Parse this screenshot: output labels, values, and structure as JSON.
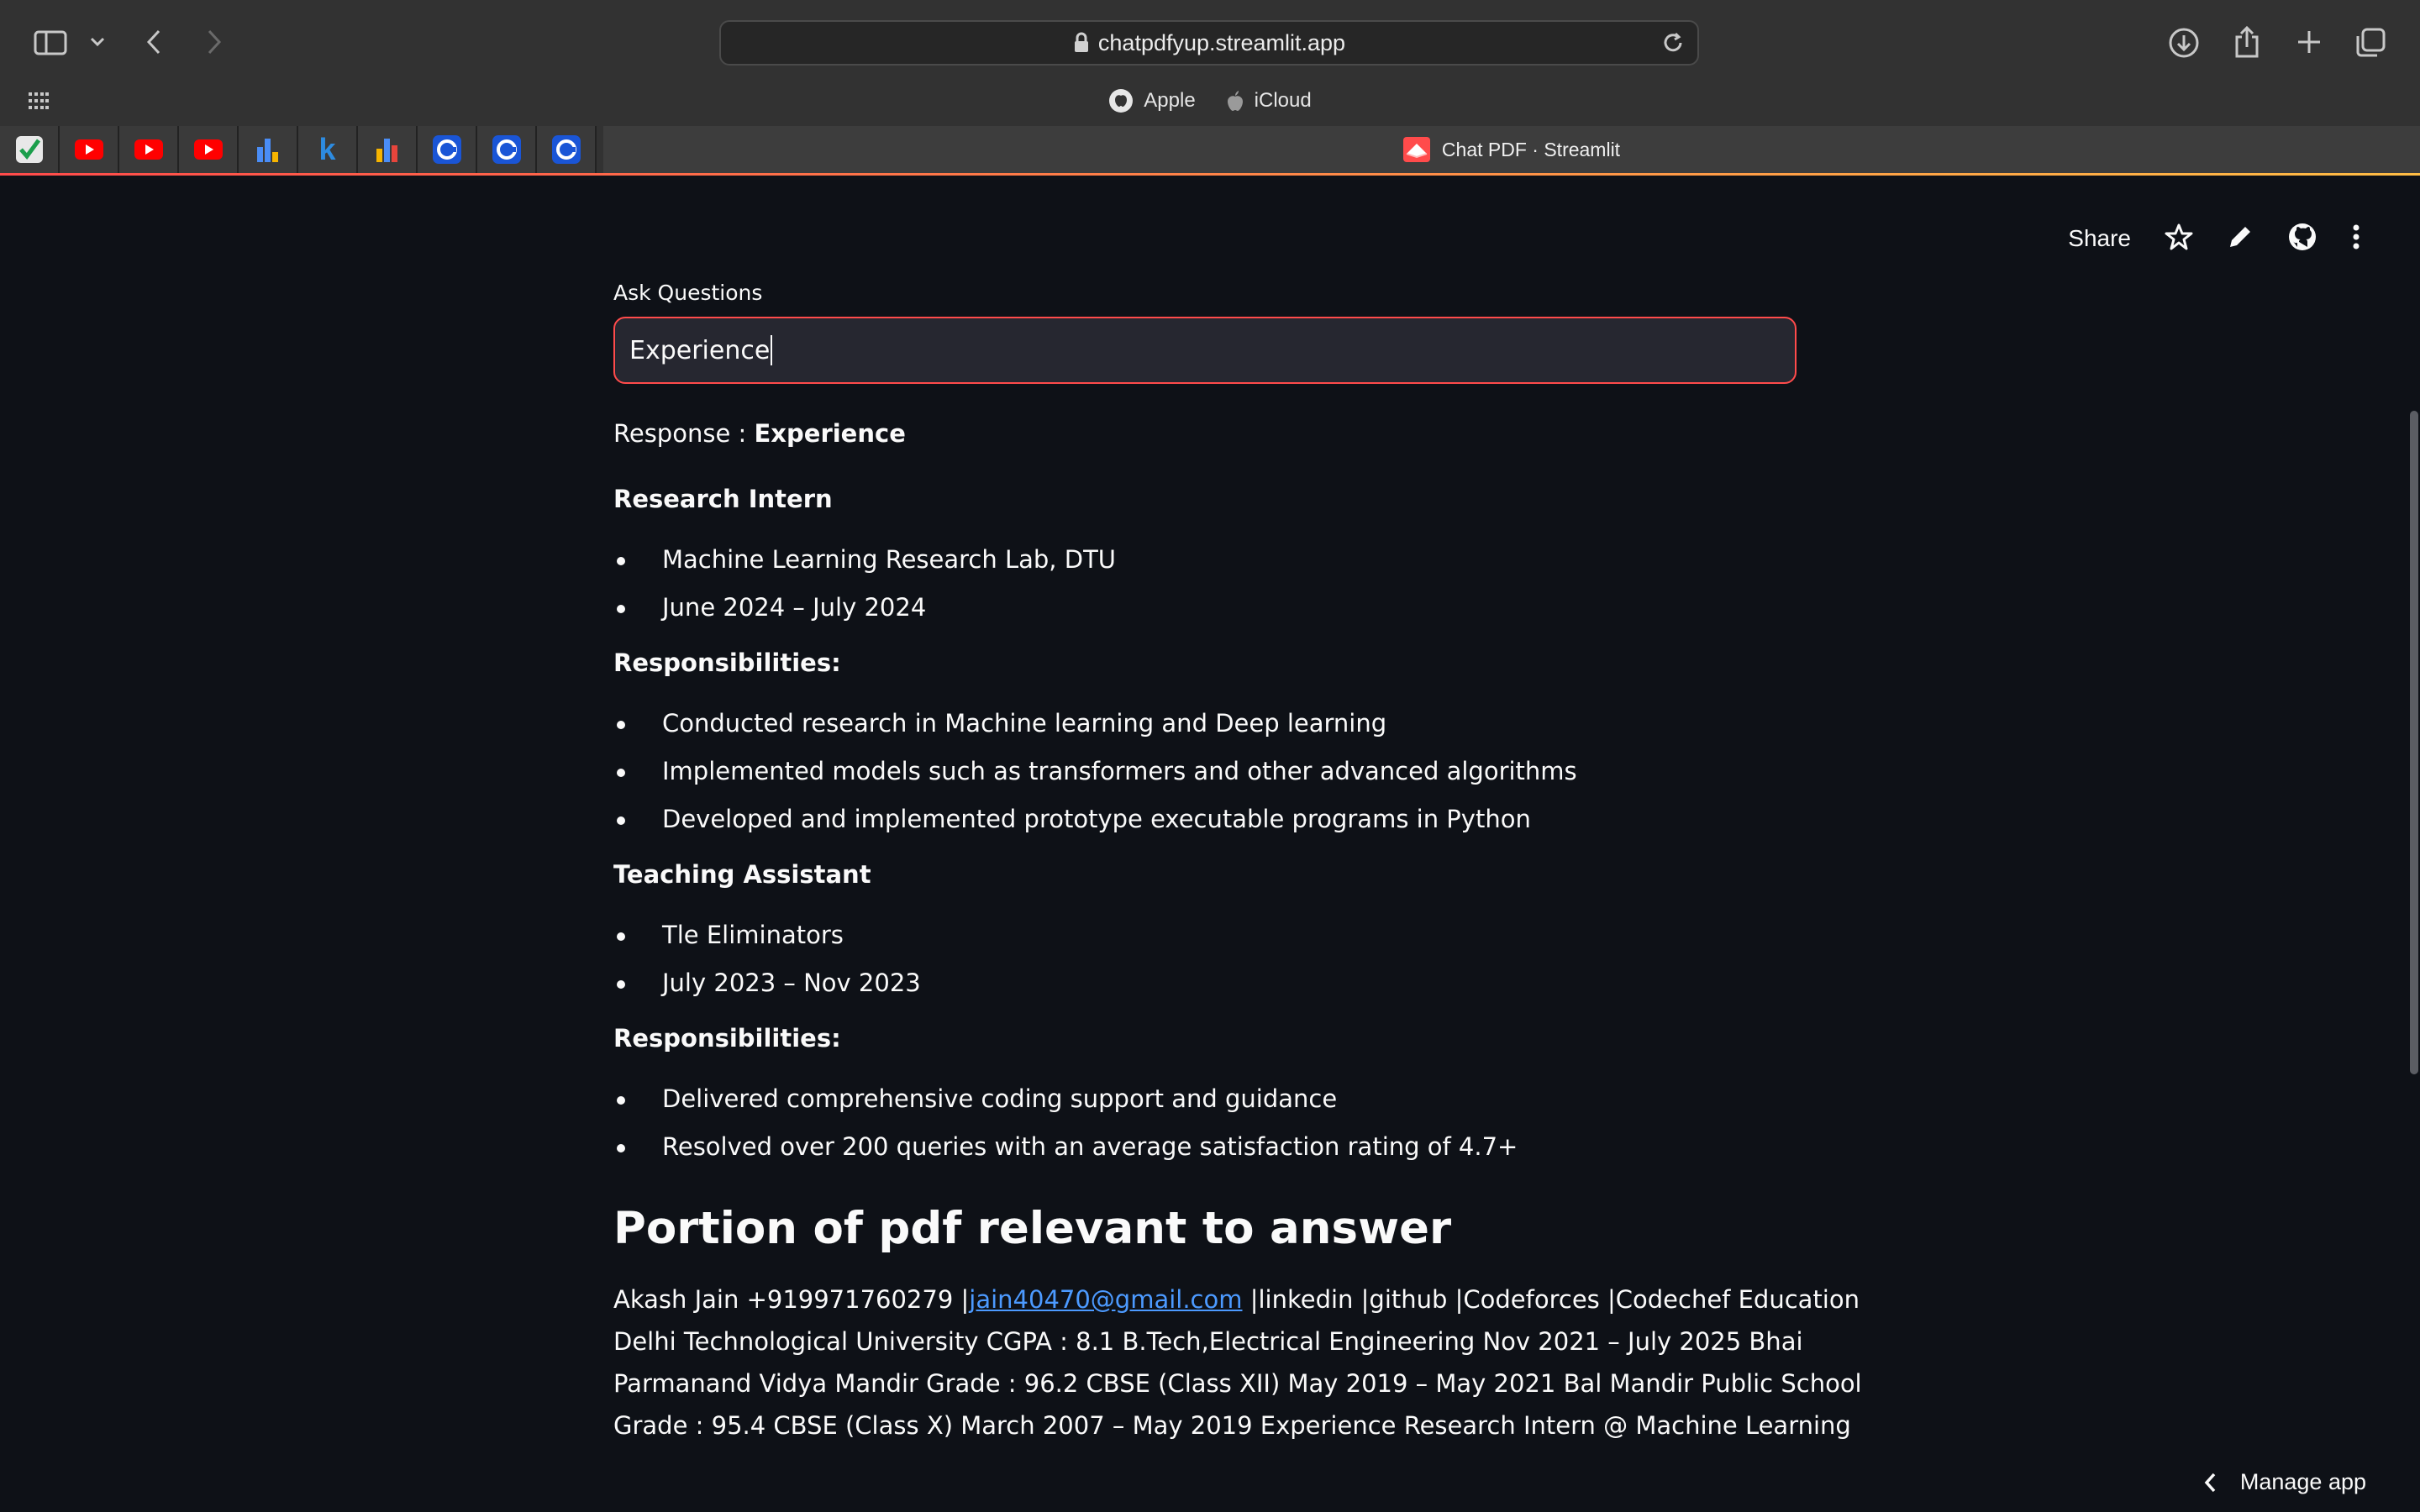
{
  "browser": {
    "url": "chatpdfyup.streamlit.app",
    "favorites": [
      {
        "label": "Apple",
        "icon": "apple-logo-icon"
      },
      {
        "label": "iCloud",
        "icon": "apple-icon"
      }
    ],
    "active_tab": "Chat PDF · Streamlit"
  },
  "app": {
    "share_label": "Share",
    "manage_label": "Manage app",
    "input_label": "Ask Questions",
    "input_value": "Experience",
    "response_prefix": "Response : ",
    "response_title": "Experience",
    "job1": {
      "title": "Research Intern",
      "details": [
        "Machine Learning Research Lab, DTU",
        "June 2024 – July 2024"
      ],
      "resp_heading": "Responsibilities:",
      "responsibilities": [
        "Conducted research in Machine learning and Deep learning",
        "Implemented models such as transformers and other advanced algorithms",
        "Developed and implemented prototype executable programs in Python"
      ]
    },
    "job2": {
      "title": "Teaching Assistant",
      "details": [
        "Tle Eliminators",
        "July 2023 – Nov 2023"
      ],
      "resp_heading": "Responsibilities:",
      "responsibilities": [
        "Delivered comprehensive coding support and guidance",
        "Resolved over 200 queries with an average satisfaction rating of 4.7+"
      ]
    },
    "pdf_heading": "Portion of pdf relevant to answer",
    "pdf_lines": {
      "l1_before": "Akash Jain +919971760279 |",
      "l1_link": "jain40470@gmail.com",
      "l1_after": " |linkedin |github |Codeforces |Codechef Education",
      "l2": "Delhi Technological University CGPA : 8.1 B.Tech,Electrical Engineering Nov 2021 – July 2025 Bhai",
      "l3": "Parmanand Vidya Mandir Grade : 96.2 CBSE (Class XII) May 2019 – May 2021 Bal Mandir Public School",
      "l4": "Grade : 95.4 CBSE (Class X) March 2007 – May 2019 Experience Research Intern @ Machine Learning"
    }
  },
  "colors": {
    "accent": "#ff4b4b",
    "background": "#0e1117",
    "link": "#4c9aff"
  }
}
